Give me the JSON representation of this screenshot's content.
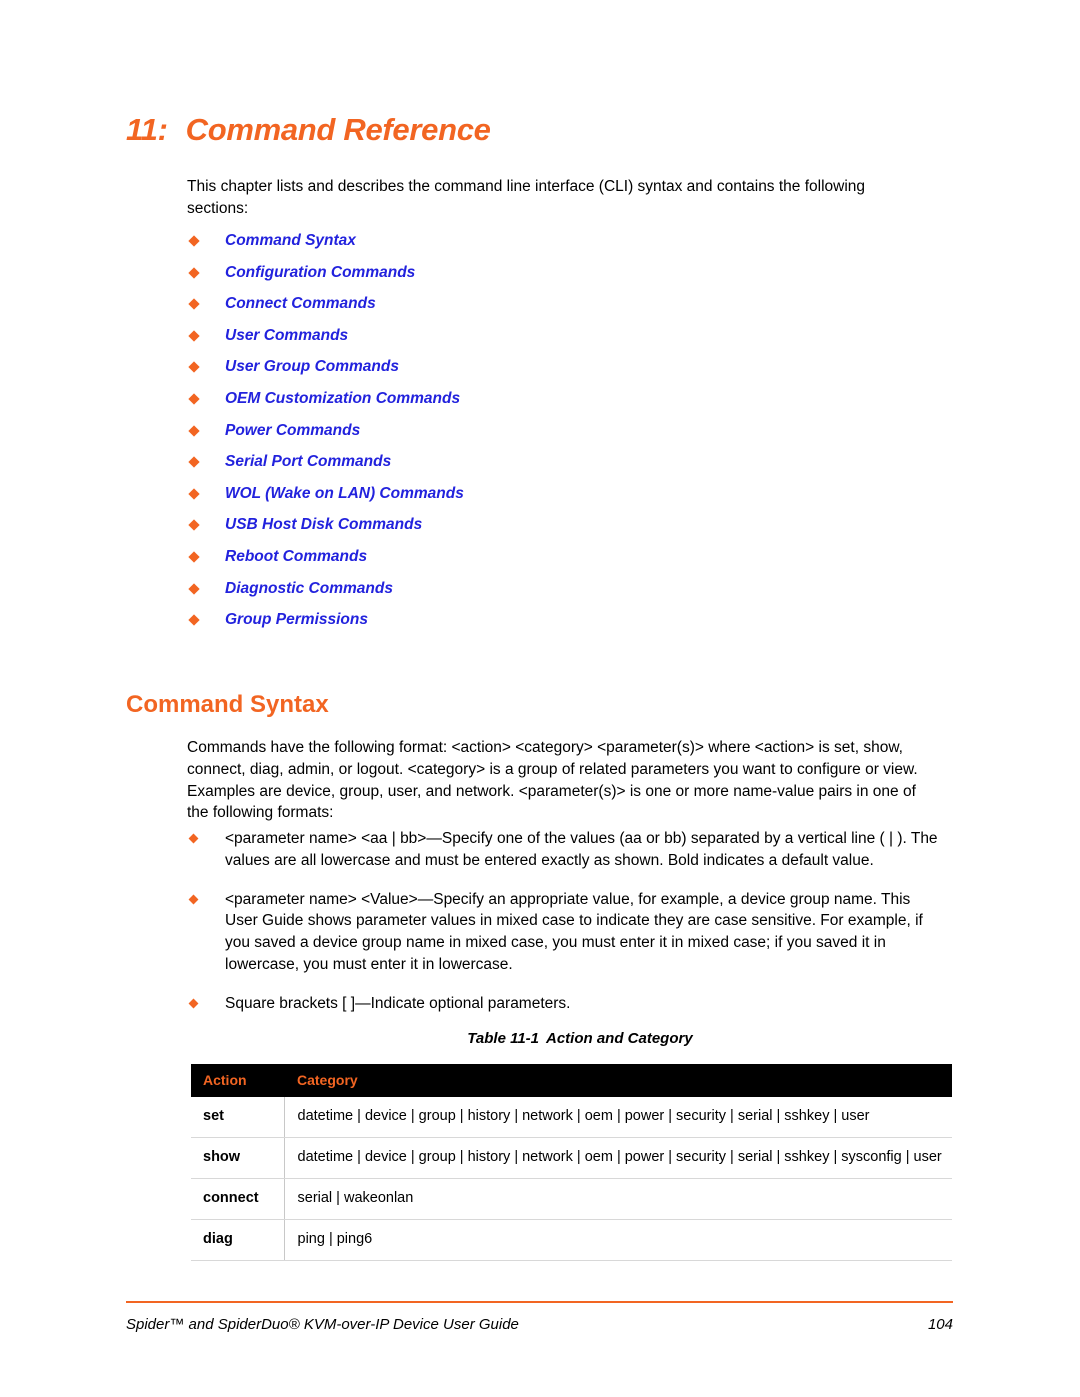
{
  "chapter": {
    "number": "11:",
    "title": "Command Reference"
  },
  "intro": "This chapter lists and describes the command line interface (CLI) syntax and contains the following sections:",
  "toc": {
    "items": [
      {
        "label": "Command Syntax"
      },
      {
        "label": "Configuration Commands"
      },
      {
        "label": "Connect Commands"
      },
      {
        "label": "User Commands"
      },
      {
        "label": "User Group Commands"
      },
      {
        "label": "OEM Customization Commands"
      },
      {
        "label": "Power Commands"
      },
      {
        "label": "Serial Port Commands"
      },
      {
        "label": "WOL (Wake on LAN) Commands"
      },
      {
        "label": "USB Host Disk Commands"
      },
      {
        "label": "Reboot Commands"
      },
      {
        "label": "Diagnostic Commands"
      },
      {
        "label": "Group Permissions"
      }
    ]
  },
  "section": {
    "heading": "Command Syntax",
    "paragraph": "Commands have the following format: <action> <category> <parameter(s)> where <action> is set, show, connect, diag, admin, or logout. <category> is a group of related parameters you want to configure or view. Examples are device, group, user, and network. <parameter(s)> is one or more name-value pairs in one of the following formats:",
    "bullets": [
      "<parameter name> <aa | bb>—Specify one of the values (aa or bb) separated by a vertical line ( | ). The values are all lowercase and must be entered exactly as shown. Bold indicates a default value.",
      "<parameter name> <Value>—Specify an appropriate value, for example, a device group name. This User Guide shows parameter values in mixed case to indicate they are case sensitive. For example, if you saved a device group name in mixed case, you must enter it in mixed case; if you saved it in lowercase, you must enter it in lowercase.",
      "Square brackets [ ]—Indicate optional parameters."
    ]
  },
  "table": {
    "caption_label": "Table 11-1",
    "caption_title": "Action and Category",
    "headers": [
      "Action",
      "Category"
    ],
    "rows": [
      {
        "action": "set",
        "category": "datetime | device | group | history | network | oem | power | security | serial | sshkey | user"
      },
      {
        "action": "show",
        "category": "datetime | device | group | history | network | oem | power | security | serial | sshkey | sysconfig | user"
      },
      {
        "action": "connect",
        "category": "serial | wakeonlan"
      },
      {
        "action": "diag",
        "category": "ping | ping6"
      }
    ]
  },
  "footer": {
    "left": "Spider™ and SpiderDuo® KVM-over-IP Device User Guide",
    "page": "104"
  },
  "colors": {
    "accent_orange": "#F26522",
    "link_blue": "#2222DD",
    "header_bg": "#000000",
    "rule_gray": "#D8D8D8"
  }
}
